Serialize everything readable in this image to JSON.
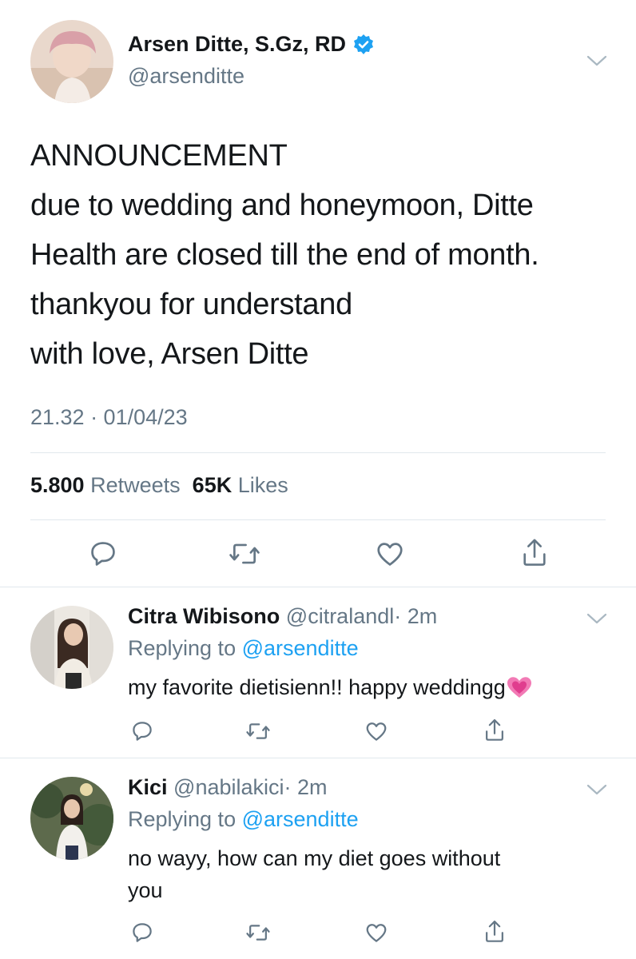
{
  "main_tweet": {
    "author_name": "Arsen Ditte, S.Gz, RD",
    "author_handle": "@arsenditte",
    "verified": true,
    "body_lines": [
      "ANNOUNCEMENT",
      "due to wedding and honeymoon, Ditte",
      "Health are closed till the end of month.",
      "thankyou for understand",
      "with love, Arsen Ditte"
    ],
    "timestamp": "21.32 · 01/04/23",
    "retweets_count": "5.800",
    "retweets_label": "Retweets",
    "likes_count": "65K",
    "likes_label": "Likes",
    "actions": [
      "reply-icon",
      "retweet-icon",
      "like-icon",
      "share-icon"
    ]
  },
  "replies": [
    {
      "author_name": "Citra Wibisono",
      "author_handle": "@citralandl",
      "time": "· 2m",
      "replying_prefix": "Replying to",
      "replying_to": "@arsenditte",
      "text": "my favorite dietisienn!! happy weddingg",
      "emoji": "pink-heart-emoji"
    },
    {
      "author_name": "Kici",
      "author_handle": "@nabilakici",
      "time": "· 2m",
      "replying_prefix": "Replying to",
      "replying_to": "@arsenditte",
      "text_lines": [
        "no wayy, how can my diet goes without",
        "you"
      ]
    }
  ],
  "colors": {
    "text_primary": "#14171a",
    "text_secondary": "#657786",
    "accent": "#1da1f2",
    "divider": "#e1e8ed"
  }
}
